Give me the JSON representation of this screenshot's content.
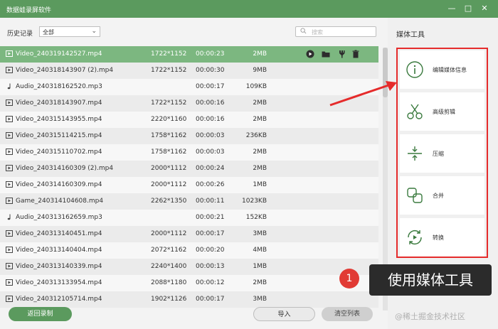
{
  "window": {
    "title": "数据蛙录屏软件"
  },
  "filter": {
    "history_label": "历史记录",
    "selected": "全部",
    "search_placeholder": "搜索"
  },
  "files": [
    {
      "type": "video",
      "name": "Video_240319142527.mp4",
      "res": "1722*1152",
      "dur": "00:00:23",
      "size": "2MB"
    },
    {
      "type": "video",
      "name": "Video_240318143907 (2).mp4",
      "res": "1722*1152",
      "dur": "00:00:30",
      "size": "9MB"
    },
    {
      "type": "audio",
      "name": "Audio_240318162520.mp3",
      "res": "",
      "dur": "00:00:17",
      "size": "109KB"
    },
    {
      "type": "video",
      "name": "Video_240318143907.mp4",
      "res": "1722*1152",
      "dur": "00:00:16",
      "size": "2MB"
    },
    {
      "type": "video",
      "name": "Video_240315143955.mp4",
      "res": "2220*1160",
      "dur": "00:00:16",
      "size": "2MB"
    },
    {
      "type": "video",
      "name": "Video_240315114215.mp4",
      "res": "1758*1162",
      "dur": "00:00:03",
      "size": "236KB"
    },
    {
      "type": "video",
      "name": "Video_240315110702.mp4",
      "res": "1758*1162",
      "dur": "00:00:03",
      "size": "2MB"
    },
    {
      "type": "video",
      "name": "Video_240314160309 (2).mp4",
      "res": "2000*1112",
      "dur": "00:00:24",
      "size": "2MB"
    },
    {
      "type": "video",
      "name": "Video_240314160309.mp4",
      "res": "2000*1112",
      "dur": "00:00:26",
      "size": "1MB"
    },
    {
      "type": "game",
      "name": "Game_240314104608.mp4",
      "res": "2262*1350",
      "dur": "00:00:11",
      "size": "1023KB"
    },
    {
      "type": "audio",
      "name": "Audio_240313162659.mp3",
      "res": "",
      "dur": "00:00:21",
      "size": "152KB"
    },
    {
      "type": "video",
      "name": "Video_240313140451.mp4",
      "res": "2000*1112",
      "dur": "00:00:17",
      "size": "3MB"
    },
    {
      "type": "video",
      "name": "Video_240313140404.mp4",
      "res": "2072*1162",
      "dur": "00:00:20",
      "size": "4MB"
    },
    {
      "type": "video",
      "name": "Video_240313140339.mp4",
      "res": "2240*1400",
      "dur": "00:00:13",
      "size": "1MB"
    },
    {
      "type": "video",
      "name": "Video_240313133954.mp4",
      "res": "2088*1180",
      "dur": "00:00:12",
      "size": "2MB"
    },
    {
      "type": "video",
      "name": "Video_240312105714.mp4",
      "res": "1902*1126",
      "dur": "00:00:17",
      "size": "3MB"
    }
  ],
  "buttons": {
    "back": "返回录制",
    "import": "导入",
    "clear": "清空列表"
  },
  "tools": {
    "title": "媒体工具",
    "items": [
      {
        "label": "编辑媒体信息",
        "icon": "info-icon"
      },
      {
        "label": "高级剪辑",
        "icon": "scissors-icon"
      },
      {
        "label": "压缩",
        "icon": "compress-icon"
      },
      {
        "label": "合并",
        "icon": "merge-icon"
      },
      {
        "label": "转换",
        "icon": "convert-icon"
      }
    ]
  },
  "callout": {
    "number": "1",
    "text": "使用媒体工具"
  },
  "watermark": "@稀土掘金技术社区",
  "colors": {
    "brand_green": "#5b9a5e",
    "selected_row": "#7cb780",
    "highlight_red": "#e52b2b"
  }
}
